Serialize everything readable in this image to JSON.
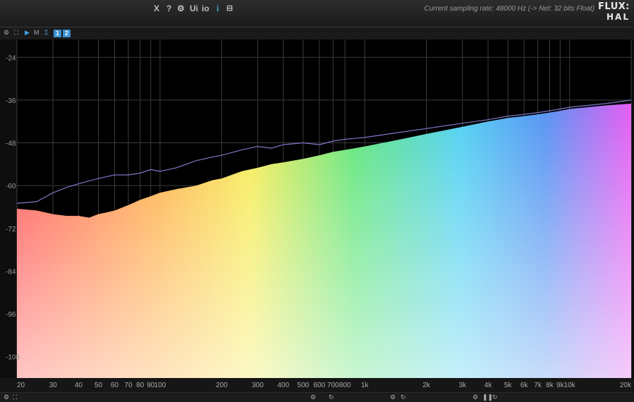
{
  "toolbar": {
    "buttons": [
      "X",
      "?",
      "⚙",
      "Ui",
      "io",
      "i",
      "⊟"
    ]
  },
  "status_text": "Current sampling rate: 48000 Hz (-> Net: 32 bits Float)",
  "logo": {
    "line1": "FLUX:",
    "line2": "HAL"
  },
  "subbar": {
    "icons": [
      "gear-icon",
      "expand-icon",
      "play-icon",
      "m-icon",
      "sigma-icon"
    ],
    "m_label": "M",
    "sigma_label": "Σ",
    "tab1_label": "1",
    "tab2_label": "2"
  },
  "colors": {
    "background": "#000000",
    "grid": "#3c3c3c",
    "peak_line": "#7a78c8"
  },
  "chart_data": {
    "type": "area",
    "x_scale": "log",
    "xlim": [
      20,
      20000
    ],
    "ylim": [
      -114,
      -19
    ],
    "ytick_labels": [
      "-24",
      "-36",
      "-48",
      "-60",
      "-72",
      "-84",
      "-96",
      "-108"
    ],
    "xtick_labels": [
      "20",
      "30",
      "40",
      "50",
      "60",
      "70",
      "80",
      "90",
      "100",
      "200",
      "300",
      "400",
      "500",
      "600",
      "700",
      "800",
      "1k",
      "2k",
      "3k",
      "4k",
      "5k",
      "6k",
      "7k",
      "8k",
      "9k",
      "10k",
      "20k"
    ],
    "xtick_values": [
      20,
      30,
      40,
      50,
      60,
      70,
      80,
      90,
      100,
      200,
      300,
      400,
      500,
      600,
      700,
      800,
      1000,
      2000,
      3000,
      4000,
      5000,
      6000,
      7000,
      8000,
      9000,
      10000,
      20000
    ],
    "series": [
      {
        "points": [
          [
            20,
            -66.5
          ],
          [
            25,
            -67
          ],
          [
            30,
            -68
          ],
          [
            35,
            -68.5
          ],
          [
            40,
            -68.5
          ],
          [
            45,
            -69
          ],
          [
            50,
            -68
          ],
          [
            55,
            -67.5
          ],
          [
            60,
            -67
          ],
          [
            70,
            -65.5
          ],
          [
            80,
            -64
          ],
          [
            90,
            -63
          ],
          [
            100,
            -62
          ],
          [
            120,
            -61
          ],
          [
            150,
            -60
          ],
          [
            180,
            -58.5
          ],
          [
            200,
            -58
          ],
          [
            250,
            -56
          ],
          [
            300,
            -55
          ],
          [
            350,
            -54
          ],
          [
            400,
            -53.5
          ],
          [
            500,
            -52.5
          ],
          [
            600,
            -51.5
          ],
          [
            700,
            -50.5
          ],
          [
            800,
            -50
          ],
          [
            1000,
            -49
          ],
          [
            1500,
            -47
          ],
          [
            2000,
            -45.5
          ],
          [
            3000,
            -43.5
          ],
          [
            4000,
            -42
          ],
          [
            5000,
            -41
          ],
          [
            6000,
            -40.5
          ],
          [
            7000,
            -40
          ],
          [
            8000,
            -39.5
          ],
          [
            9000,
            -39
          ],
          [
            10000,
            -38.5
          ],
          [
            15000,
            -37.5
          ],
          [
            20000,
            -37
          ]
        ]
      },
      {
        "points": [
          [
            20,
            -65
          ],
          [
            25,
            -64.5
          ],
          [
            30,
            -62
          ],
          [
            35,
            -60.5
          ],
          [
            40,
            -59.5
          ],
          [
            50,
            -58
          ],
          [
            60,
            -57
          ],
          [
            70,
            -57
          ],
          [
            80,
            -56.5
          ],
          [
            90,
            -55.5
          ],
          [
            100,
            -56
          ],
          [
            120,
            -55
          ],
          [
            150,
            -53
          ],
          [
            180,
            -52
          ],
          [
            200,
            -51.5
          ],
          [
            250,
            -50
          ],
          [
            300,
            -49
          ],
          [
            350,
            -49.5
          ],
          [
            400,
            -48.5
          ],
          [
            500,
            -48
          ],
          [
            600,
            -48.5
          ],
          [
            700,
            -47.5
          ],
          [
            800,
            -47
          ],
          [
            1000,
            -46.5
          ],
          [
            1500,
            -45
          ],
          [
            2000,
            -44
          ],
          [
            3000,
            -42.5
          ],
          [
            4000,
            -41.5
          ],
          [
            5000,
            -40.5
          ],
          [
            6000,
            -40
          ],
          [
            7000,
            -39.5
          ],
          [
            8000,
            -39
          ],
          [
            9000,
            -38.5
          ],
          [
            10000,
            -38
          ],
          [
            15000,
            -37
          ],
          [
            20000,
            -36
          ]
        ]
      }
    ]
  }
}
